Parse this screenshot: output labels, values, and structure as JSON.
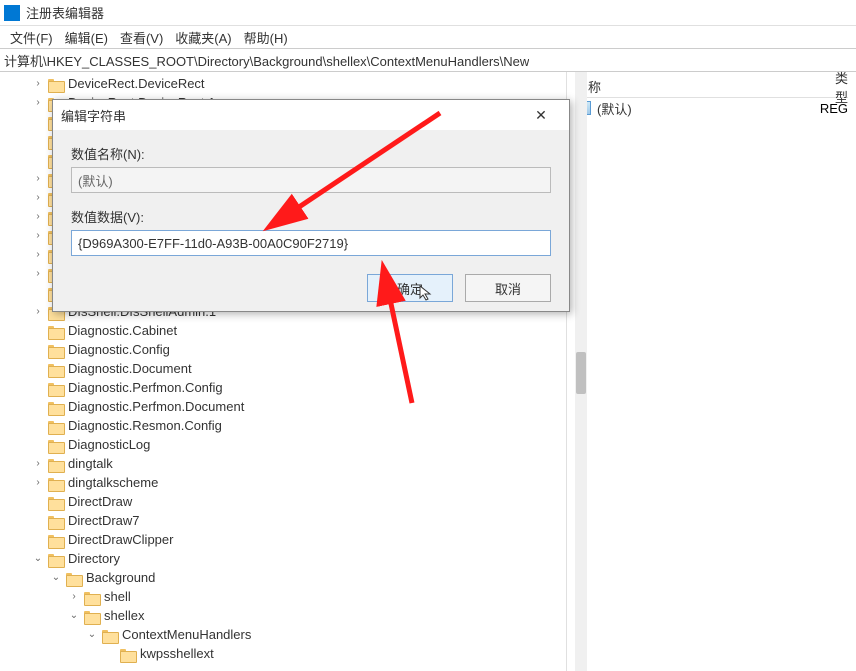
{
  "app": {
    "title": "注册表编辑器"
  },
  "menu": {
    "file": "文件(F)",
    "edit": "编辑(E)",
    "view": "查看(V)",
    "fav": "收藏夹(A)",
    "help": "帮助(H)"
  },
  "address": "计算机\\HKEY_CLASSES_ROOT\\Directory\\Background\\shellex\\ContextMenuHandlers\\New",
  "list": {
    "header_name": "名称",
    "header_type": "类型",
    "row0_name": "(默认)",
    "row0_type": "REG"
  },
  "tree": [
    {
      "indent": 30,
      "exp": ">",
      "label": "DeviceRect.DeviceRect"
    },
    {
      "indent": 30,
      "exp": ">",
      "label": "DeviceRect.DeviceRect.1"
    },
    {
      "indent": 30,
      "exp": "",
      "label": ""
    },
    {
      "indent": 30,
      "exp": "",
      "label": ""
    },
    {
      "indent": 30,
      "exp": "",
      "label": ""
    },
    {
      "indent": 30,
      "exp": ">",
      "label": ""
    },
    {
      "indent": 30,
      "exp": ">",
      "label": ""
    },
    {
      "indent": 30,
      "exp": ">",
      "label": ""
    },
    {
      "indent": 30,
      "exp": ">",
      "label": ""
    },
    {
      "indent": 30,
      "exp": ">",
      "label": ""
    },
    {
      "indent": 30,
      "exp": ">",
      "label": ""
    },
    {
      "indent": 30,
      "exp": "",
      "label": ""
    },
    {
      "indent": 30,
      "exp": ">",
      "label": "DfsShell.DfsShellAdmin.1"
    },
    {
      "indent": 30,
      "exp": "",
      "label": "Diagnostic.Cabinet"
    },
    {
      "indent": 30,
      "exp": "",
      "label": "Diagnostic.Config"
    },
    {
      "indent": 30,
      "exp": "",
      "label": "Diagnostic.Document"
    },
    {
      "indent": 30,
      "exp": "",
      "label": "Diagnostic.Perfmon.Config"
    },
    {
      "indent": 30,
      "exp": "",
      "label": "Diagnostic.Perfmon.Document"
    },
    {
      "indent": 30,
      "exp": "",
      "label": "Diagnostic.Resmon.Config"
    },
    {
      "indent": 30,
      "exp": "",
      "label": "DiagnosticLog"
    },
    {
      "indent": 30,
      "exp": ">",
      "label": "dingtalk"
    },
    {
      "indent": 30,
      "exp": ">",
      "label": "dingtalkscheme"
    },
    {
      "indent": 30,
      "exp": "",
      "label": "DirectDraw"
    },
    {
      "indent": 30,
      "exp": "",
      "label": "DirectDraw7"
    },
    {
      "indent": 30,
      "exp": "",
      "label": "DirectDrawClipper"
    },
    {
      "indent": 30,
      "exp": "v",
      "label": "Directory"
    },
    {
      "indent": 48,
      "exp": "v",
      "label": "Background"
    },
    {
      "indent": 66,
      "exp": ">",
      "label": "shell"
    },
    {
      "indent": 66,
      "exp": "v",
      "label": "shellex"
    },
    {
      "indent": 84,
      "exp": "v",
      "label": "ContextMenuHandlers"
    },
    {
      "indent": 102,
      "exp": "",
      "label": "kwpsshellext"
    }
  ],
  "dialog": {
    "title": "编辑字符串",
    "name_label": "数值名称(N):",
    "name_value": "(默认)",
    "data_label": "数值数据(V):",
    "data_value": "{D969A300-E7FF-11d0-A93B-00A0C90F2719}",
    "ok": "确定",
    "cancel": "取消"
  }
}
